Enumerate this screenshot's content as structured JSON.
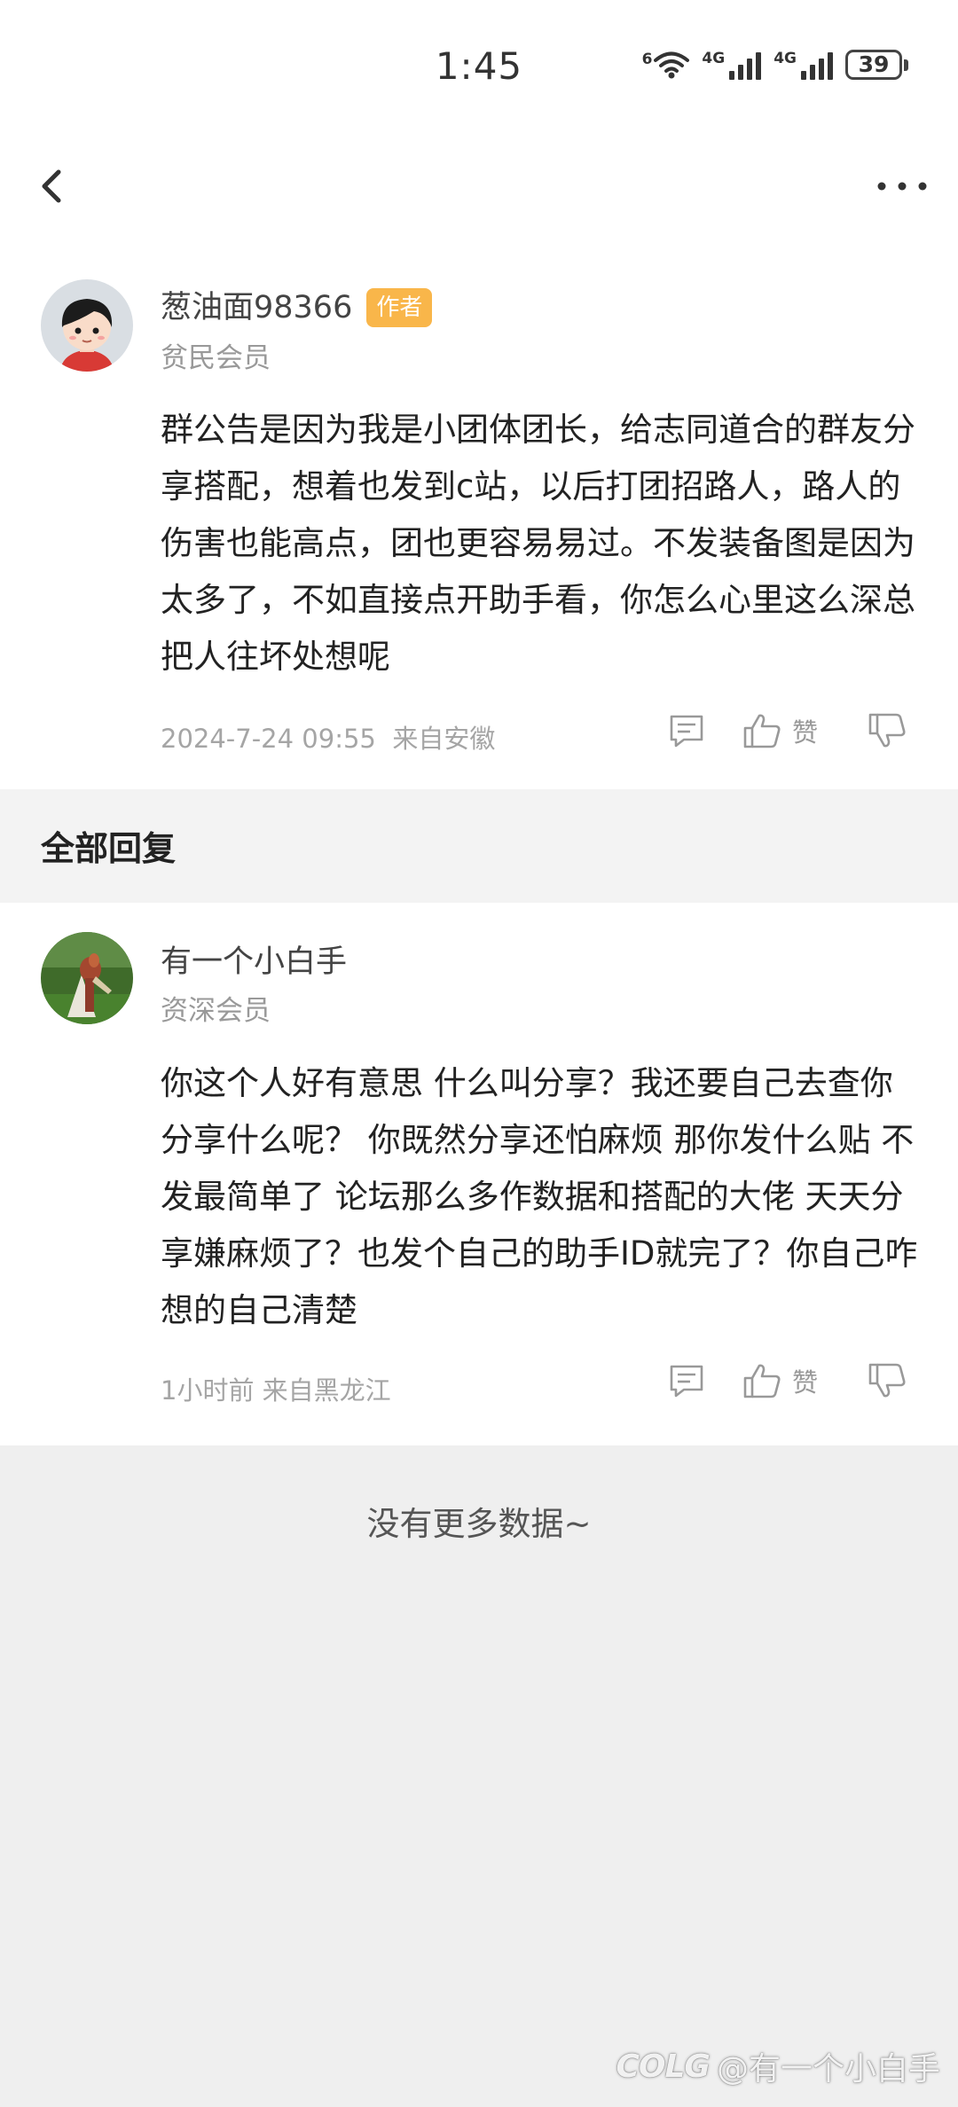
{
  "status_bar": {
    "time": "1:45",
    "network1": "4G",
    "network2": "4G",
    "wifi_tag": "6",
    "battery": "39"
  },
  "nav": {
    "back_icon": "chevron-left-icon",
    "more_icon": "more-horizontal-icon"
  },
  "post": {
    "user_name": "葱油面98366",
    "badge": "作者",
    "level": "贫民会员",
    "content": "群公告是因为我是小团体团长，给志同道合的群友分享搭配，想着也发到c站，以后打团招路人，路人的伤害也能高点，团也更容易易过。不发装备图是因为太多了，不如直接点开助手看，你怎么心里这么深总把人往坏处想呢",
    "time": "2024-7-24 09:55",
    "location": "来自安徽",
    "like_label": "赞"
  },
  "section": {
    "title": "全部回复"
  },
  "reply": {
    "user_name": "有一个小白手",
    "level": "资深会员",
    "content": "你这个人好有意思   什么叫分享？我还要自己去查你分享什么呢？ 你既然分享还怕麻烦  那你发什么贴  不发最简单了  论坛那么多作数据和搭配的大佬   天天分享嫌麻烦了？也发个自己的助手ID就完了？你自己咋想的自己清楚",
    "time": "1小时前",
    "location": "来自黑龙江",
    "like_label": "赞"
  },
  "footer": {
    "no_more": "没有更多数据~",
    "watermark_logo": "COLG",
    "watermark_user": "@有一个小白手"
  },
  "colors": {
    "badge": "#f9b64a",
    "page_bg": "#efefef",
    "card_bg": "#ffffff"
  }
}
